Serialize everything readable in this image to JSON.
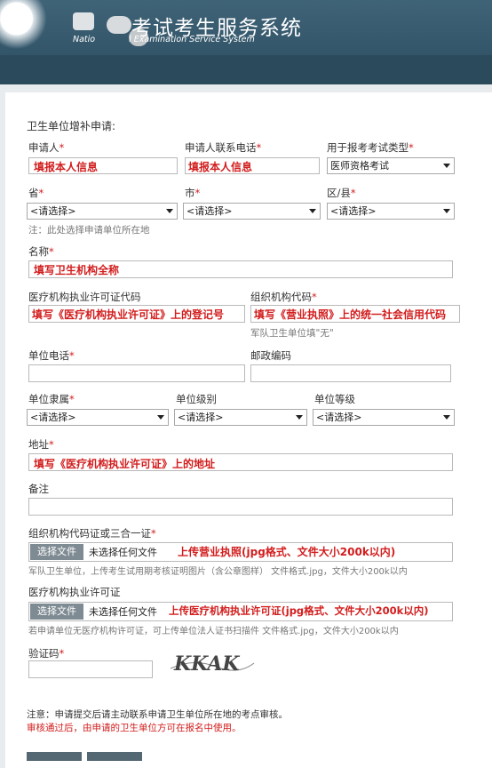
{
  "header": {
    "title_cn": "考试考生服务系统",
    "title_en_left": "Natio",
    "title_en_right": "l Examination Service System"
  },
  "form": {
    "section_title": "卫生单位增补申请:",
    "applicant": {
      "label": "申请人",
      "value": "填报本人信息"
    },
    "applicant_phone": {
      "label": "申请人联系电话",
      "value": "填报本人信息"
    },
    "exam_type": {
      "label": "用于报考考试类型",
      "value": "医师资格考试"
    },
    "province": {
      "label": "省",
      "value": "<请选择>"
    },
    "city": {
      "label": "市",
      "value": "<请选择>"
    },
    "district": {
      "label": "区/县",
      "value": "<请选择>"
    },
    "location_note": "注：此处选择申请单位所在地",
    "name": {
      "label": "名称",
      "value": "填写卫生机构全称"
    },
    "license_code": {
      "label": "医疗机构执业许可证代码",
      "value": "填写《医疗机构执业许可证》上的登记号"
    },
    "org_code": {
      "label": "组织机构代码",
      "value": "填写《营业执照》上的统一社会信用代码",
      "note": "军队卫生单位填\"无\""
    },
    "unit_phone": {
      "label": "单位电话",
      "value": ""
    },
    "postcode": {
      "label": "邮政编码",
      "value": ""
    },
    "affiliation": {
      "label": "单位隶属",
      "value": "<请选择>"
    },
    "unit_level": {
      "label": "单位级别",
      "value": "<请选择>"
    },
    "unit_grade": {
      "label": "单位等级",
      "value": "<请选择>"
    },
    "address": {
      "label": "地址",
      "value": "填写《医疗机构执业许可证》上的地址"
    },
    "remark": {
      "label": "备注",
      "value": ""
    },
    "org_cert_upload": {
      "label": "组织机构代码证或三合一证",
      "button": "选择文件",
      "status": "未选择任何文件",
      "hint": "上传营业执照(jpg格式、文件大小200k以内)",
      "note": "军队卫生单位，上传考生试用期考核证明图片（含公章图样） 文件格式.jpg，文件大小200k以内"
    },
    "license_upload": {
      "label": "医疗机构执业许可证",
      "button": "选择文件",
      "status": "未选择任何文件",
      "hint": "上传医疗机构执业许可证(jpg格式、文件大小200k以内)",
      "note": "若申请单位无医疗机构许可证，可上传单位法人证书扫描件 文件格式.jpg，文件大小200k以内"
    },
    "captcha": {
      "label": "验证码",
      "value": "",
      "image_text": "KKAK"
    },
    "footer_note1": "注意：申请提交后请主动联系申请卫生单位所在地的考点审核。",
    "footer_note2": "审核通过后，由申请的卫生单位方可在报名中使用。"
  },
  "colors": {
    "header": "#34566a",
    "required": "#d21d1d",
    "file_button": "#7f8b93"
  }
}
